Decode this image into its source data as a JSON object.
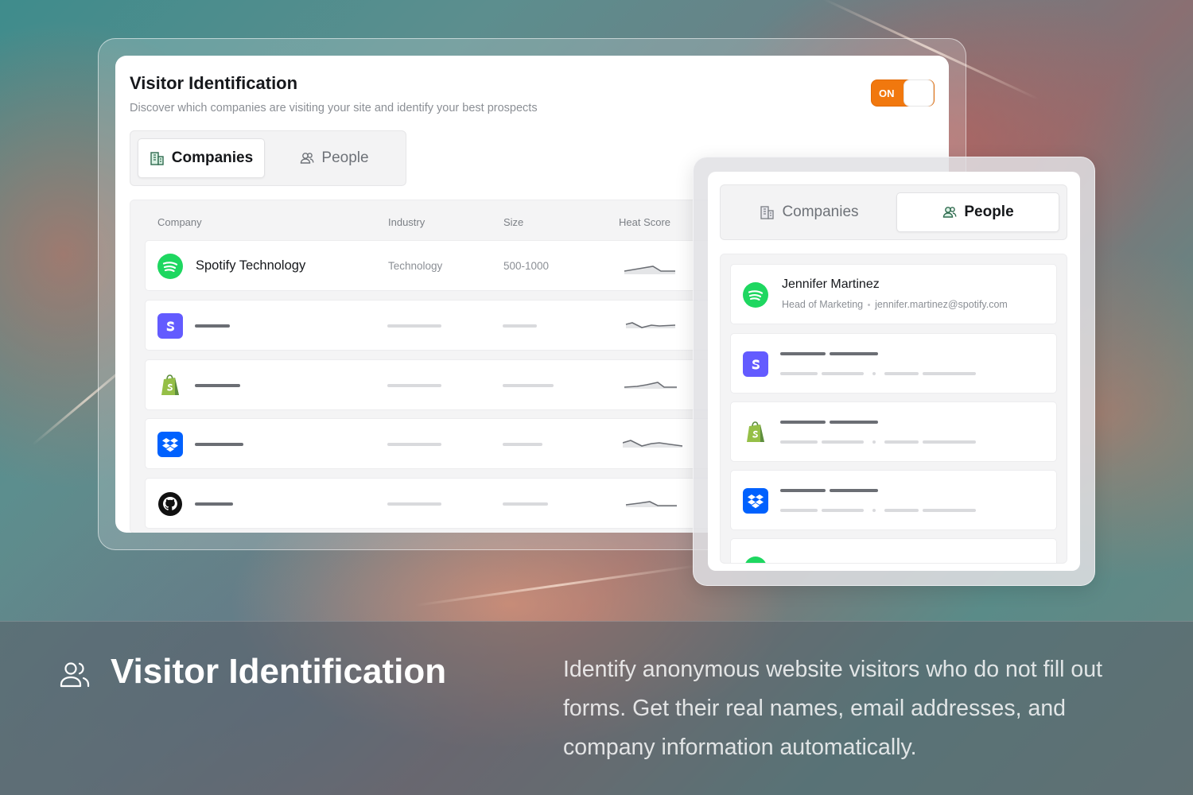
{
  "main_panel": {
    "title": "Visitor Identification",
    "subtitle": "Discover which companies are visiting your site and identify your best prospects",
    "toggle_label": "ON",
    "tabs": [
      {
        "label": "Companies",
        "icon": "building-icon",
        "active": true
      },
      {
        "label": "People",
        "icon": "users-icon",
        "active": false
      }
    ],
    "table": {
      "columns": [
        "Company",
        "Industry",
        "Size",
        "Heat Score"
      ],
      "rows": [
        {
          "logo": "spotify-logo",
          "name": "Spotify Technology",
          "industry": "Technology",
          "size": "500-1000"
        },
        {
          "logo": "stripe-logo",
          "name": "",
          "industry": "",
          "size": ""
        },
        {
          "logo": "shopify-logo",
          "name": "",
          "industry": "",
          "size": ""
        },
        {
          "logo": "dropbox-logo",
          "name": "",
          "industry": "",
          "size": ""
        },
        {
          "logo": "github-logo",
          "name": "",
          "industry": "",
          "size": ""
        }
      ]
    }
  },
  "side_panel": {
    "tabs": [
      {
        "label": "Companies",
        "icon": "building-icon",
        "active": false
      },
      {
        "label": "People",
        "icon": "users-icon",
        "active": true
      }
    ],
    "people": [
      {
        "logo": "spotify-logo",
        "name": "Jennifer Martinez",
        "role": "Head of Marketing",
        "email": "jennifer.martinez@spotify.com"
      },
      {
        "logo": "stripe-logo",
        "name": "",
        "role": "",
        "email": ""
      },
      {
        "logo": "shopify-logo",
        "name": "",
        "role": "",
        "email": ""
      },
      {
        "logo": "dropbox-logo",
        "name": "",
        "role": "",
        "email": ""
      }
    ]
  },
  "footer": {
    "icon": "users-icon",
    "title": "Visitor Identification",
    "description": "Identify anonymous website visitors who do not fill out forms. Get their real names, email addresses, and company information automatically."
  },
  "colors": {
    "toggle_on": "#f1780e",
    "spotify": "#1ed760",
    "stripe": "#635bff",
    "shopify": "#95bf47",
    "dropbox": "#0061fe",
    "github": "#111111"
  }
}
